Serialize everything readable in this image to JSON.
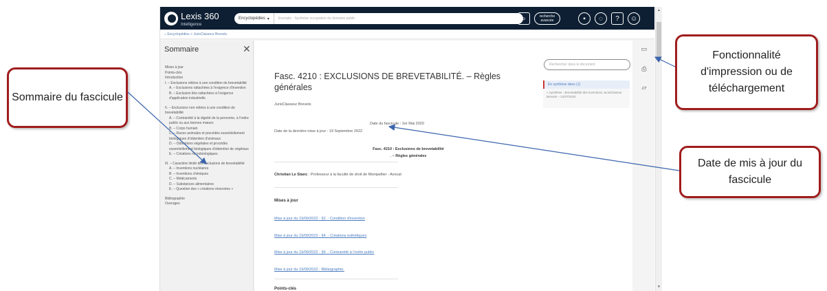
{
  "topbar": {
    "logo_text": "Lexis 360",
    "logo_sub": "Intelligence",
    "search_category": "Encyclopédies",
    "search_placeholder": "Exemple : Synthèse occupation du domaine public",
    "adv_search": "recherche avancée",
    "icons": [
      "search-icon",
      "folder-icon",
      "bell-icon",
      "help-icon",
      "user-icon"
    ]
  },
  "breadcrumb": "Encyclopédies > JurisClasseur Brevets",
  "sidebar": {
    "title": "Sommaire",
    "items": [
      {
        "label": "Mises à jour",
        "sub": false,
        "gap": false
      },
      {
        "label": "Points-clés",
        "sub": false,
        "gap": false
      },
      {
        "label": "Introduction",
        "sub": false,
        "gap": false
      },
      {
        "label": "I. – Exclusions reliées à une condition de brevetabilité",
        "sub": false,
        "gap": false
      },
      {
        "label": "A. – Exclusions rattachées à l'exigence d'invention",
        "sub": true,
        "gap": false
      },
      {
        "label": "B. – Exclusion liée rattachées à l'exigence d'application industrielle",
        "sub": true,
        "gap": false
      },
      {
        "label": "II. – Exclusions non reliées à une condition de brevetabilité",
        "sub": false,
        "gap": true
      },
      {
        "label": "A. – Contrariété à la dignité de la personne, à l'ordre public ou aux bonnes mœurs",
        "sub": true,
        "gap": false
      },
      {
        "label": "B. – Corps humain",
        "sub": true,
        "gap": false
      },
      {
        "label": "C. – Races animales et procédés essentiellement biologiques d'obtention d'animaux",
        "sub": true,
        "gap": false
      },
      {
        "label": "D. – Obtentions végétales et procédés essentiellement biologiques d'obtention de végétaux",
        "sub": true,
        "gap": false
      },
      {
        "label": "E. – Créations microbiologiques",
        "sub": true,
        "gap": false
      },
      {
        "label": "III. – Caractère limité des exclusions de brevetabilité",
        "sub": false,
        "gap": true
      },
      {
        "label": "A. – Inventions nucléaires",
        "sub": true,
        "gap": false
      },
      {
        "label": "B. – Inventions chimiques",
        "sub": true,
        "gap": false
      },
      {
        "label": "C. – Médicaments",
        "sub": true,
        "gap": false
      },
      {
        "label": "D. – Substances alimentaires",
        "sub": true,
        "gap": false
      },
      {
        "label": "E. – Question des « créations réservées »",
        "sub": true,
        "gap": false
      },
      {
        "label": "Bibliographie",
        "sub": false,
        "gap": true
      },
      {
        "label": "Ouvrages",
        "sub": false,
        "gap": false
      }
    ]
  },
  "document": {
    "title": "Fasc. 4210 : EXCLUSIONS DE BREVETABILITÉ. – Règles générales",
    "source": "JurisClasseur Brevets",
    "date_fascicule": "Date du fascicule : 1er Mai 2020",
    "date_maj": "Date de la dernière mise à jour : 19 Septembre 2022",
    "fasc_line1": "Fasc. 4210 : Exclusions de brevetabilité",
    "fasc_line2": ". – Règles générales",
    "author_name": "Christian Le Stanc",
    "author_desc": " : Professeur à la faculté de droit de Montpellier - Avocat",
    "maj_heading": "Mises à jour",
    "links": [
      "Mise à jour du 19/09/2022 - §2. - Condition d'invention",
      "Mise à jour du 19/09/2022 - §4. - Créations esthétiques",
      "Mise à jour du 19/09/2022 - §9. - Contrariété à l'ordre public",
      "Mise à jour du 19/09/2022 - Bibliographie."
    ],
    "points_heading": "Points-clés",
    "doc_search_placeholder": "Rechercher dans le document",
    "synth_head": "En synthèse dans (1)",
    "synth_body": "» Synthèse - Brevetabilité des inventions JurisClasseur Brevets – 21/07/2022"
  },
  "callouts": {
    "sommaire": "Sommaire du fascicule",
    "fonction": "Fonctionnalité d'impression ou de téléchargement",
    "date": "Date de mis à jour du fascicule"
  },
  "colors": {
    "callout_border": "#a01c1c",
    "arrow": "#3b64ad",
    "topbar": "#0e1f33"
  }
}
